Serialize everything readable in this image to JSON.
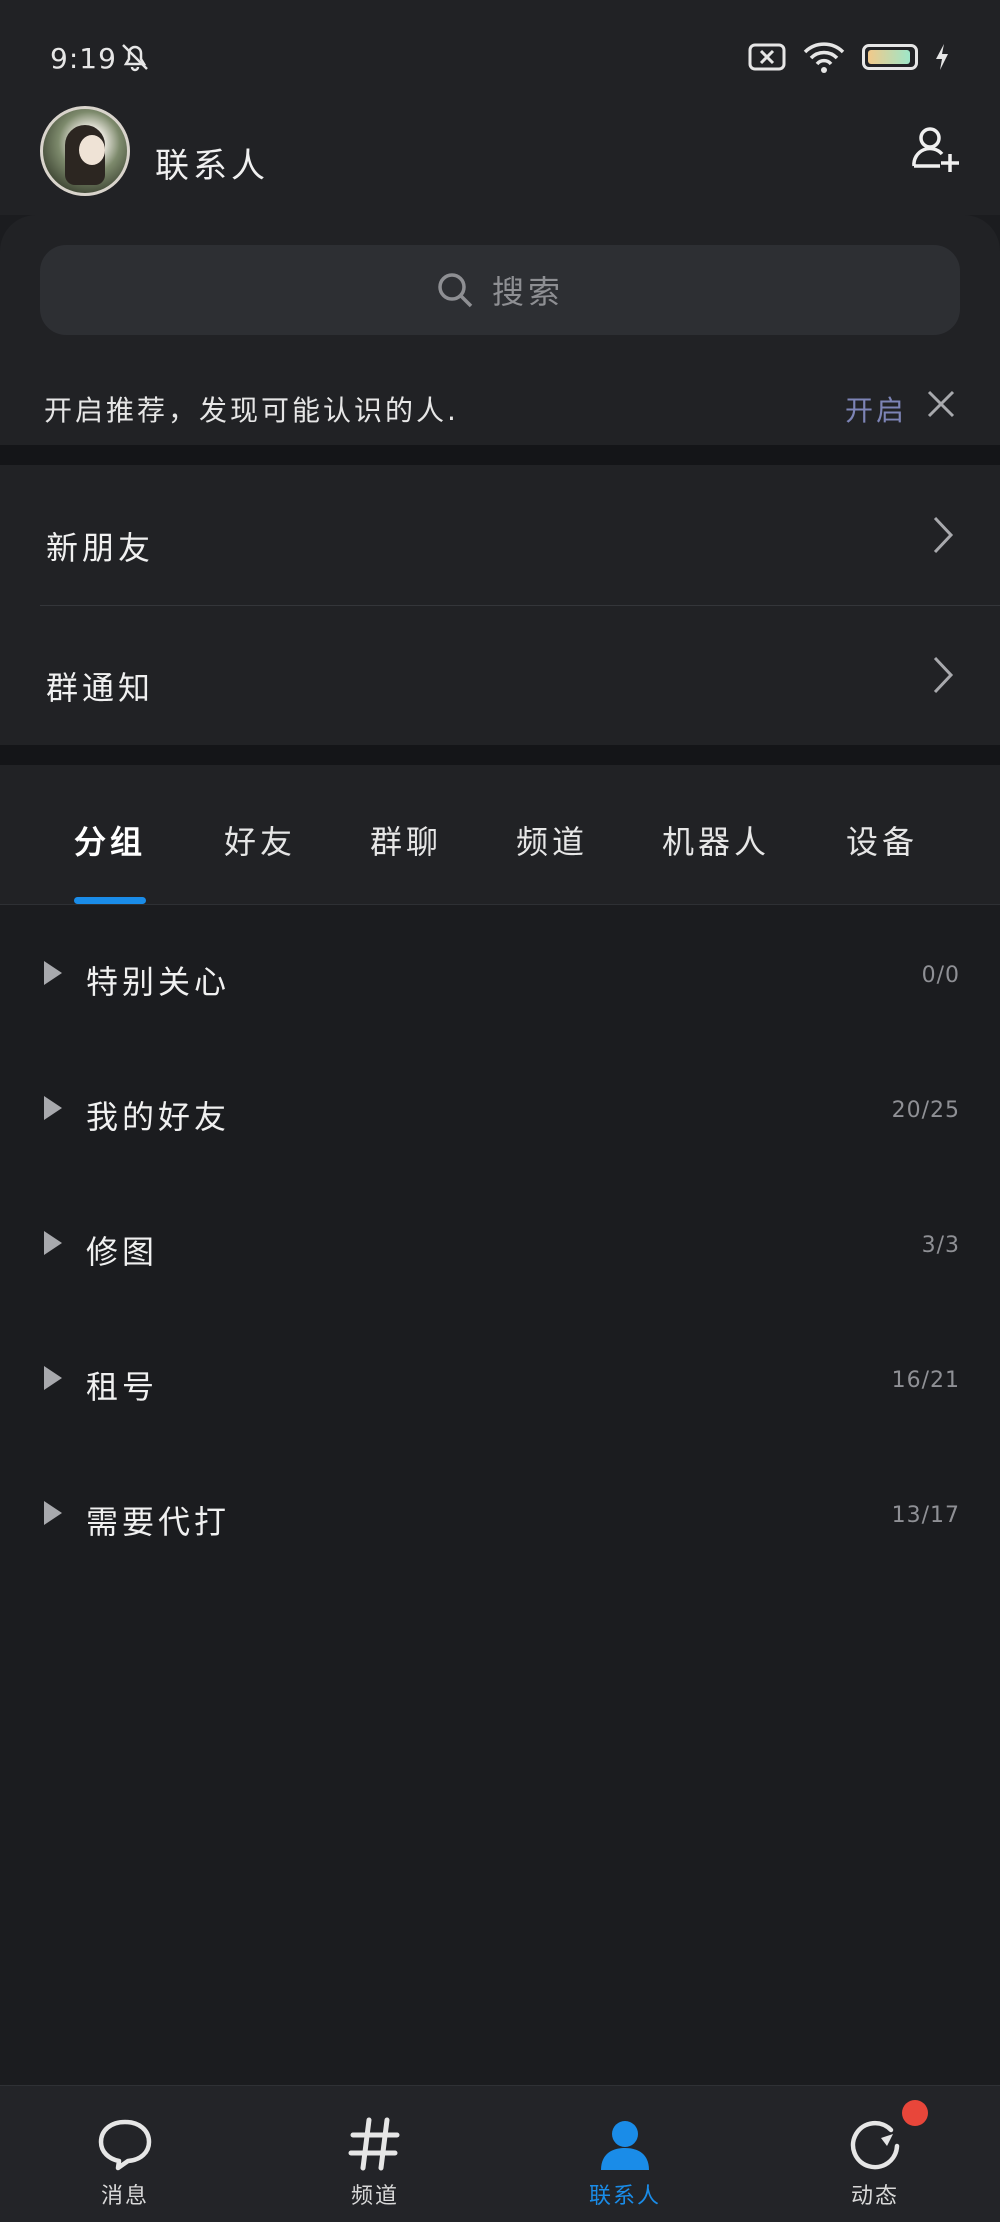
{
  "status_bar": {
    "time": "9:19"
  },
  "header": {
    "title": "联系人"
  },
  "search": {
    "placeholder": "搜索"
  },
  "recommendation": {
    "text": "开启推荐，发现可能认识的人.",
    "action": "开启"
  },
  "entries": [
    {
      "label": "新朋友"
    },
    {
      "label": "群通知"
    }
  ],
  "tabs": [
    {
      "label": "分组",
      "active": true
    },
    {
      "label": "好友"
    },
    {
      "label": "群聊"
    },
    {
      "label": "频道"
    },
    {
      "label": "机器人"
    },
    {
      "label": "设备"
    }
  ],
  "groups": [
    {
      "name": "特别关心",
      "count": "0/0"
    },
    {
      "name": "我的好友",
      "count": "20/25"
    },
    {
      "name": "修图",
      "count": "3/3"
    },
    {
      "name": "租号",
      "count": "16/21"
    },
    {
      "name": "需要代打",
      "count": "13/17"
    }
  ],
  "bottom_nav": [
    {
      "label": "消息",
      "icon": "chat-bubble-icon"
    },
    {
      "label": "频道",
      "icon": "hash-icon"
    },
    {
      "label": "联系人",
      "icon": "person-icon",
      "active": true
    },
    {
      "label": "动态",
      "icon": "refresh-star-icon"
    }
  ],
  "colors": {
    "accent": "#1a8ce8",
    "badge": "#e8463a",
    "link": "#7d84b6"
  }
}
